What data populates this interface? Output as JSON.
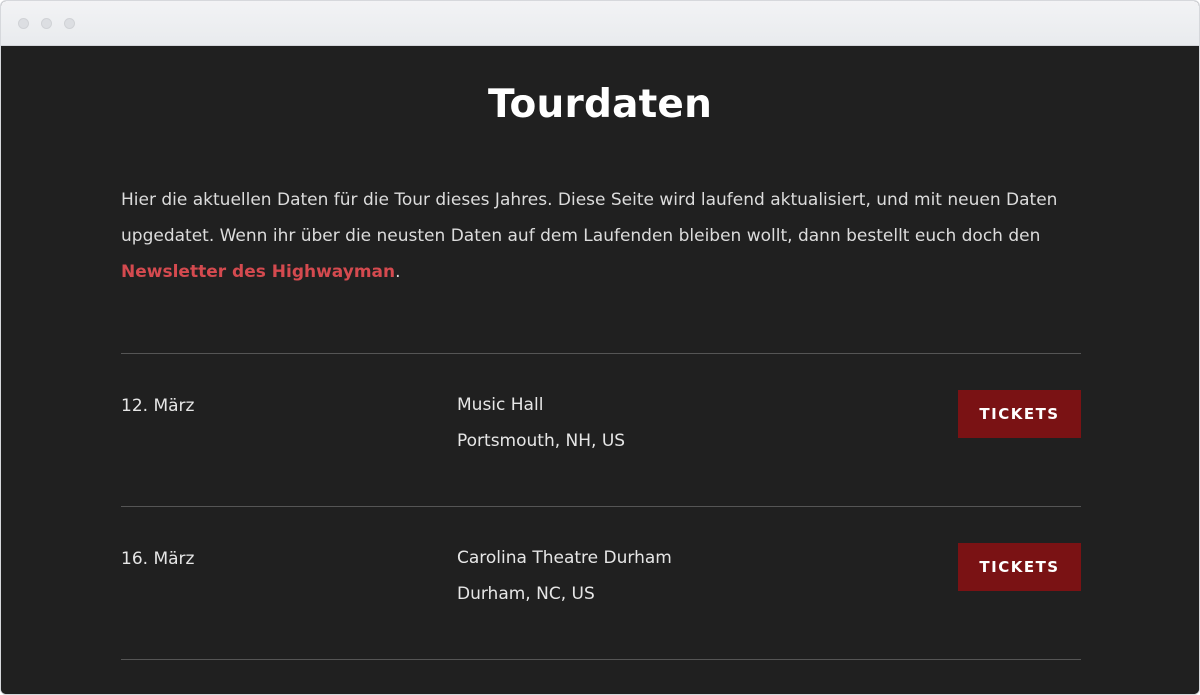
{
  "page": {
    "title": "Tourdaten",
    "intro_text": "Hier die aktuellen Daten für die Tour dieses Jahres. Diese Seite wird laufend aktualisiert, und mit neuen Daten upgedatet. Wenn ihr über die neusten Daten auf dem Laufenden bleiben wollt, dann bestellt euch doch den ",
    "newsletter_link": "Newsletter des Highwayman",
    "intro_end": "."
  },
  "tour": {
    "events": [
      {
        "date": "12. März",
        "venue": "Music Hall",
        "location": "Portsmouth, NH, US",
        "button_label": "TICKETS"
      },
      {
        "date": "16. März",
        "venue": "Carolina Theatre Durham",
        "location": "Durham, NC, US",
        "button_label": "TICKETS"
      }
    ]
  },
  "colors": {
    "background": "#202020",
    "accent_link": "#d44a4f",
    "button": "#7a1214"
  }
}
